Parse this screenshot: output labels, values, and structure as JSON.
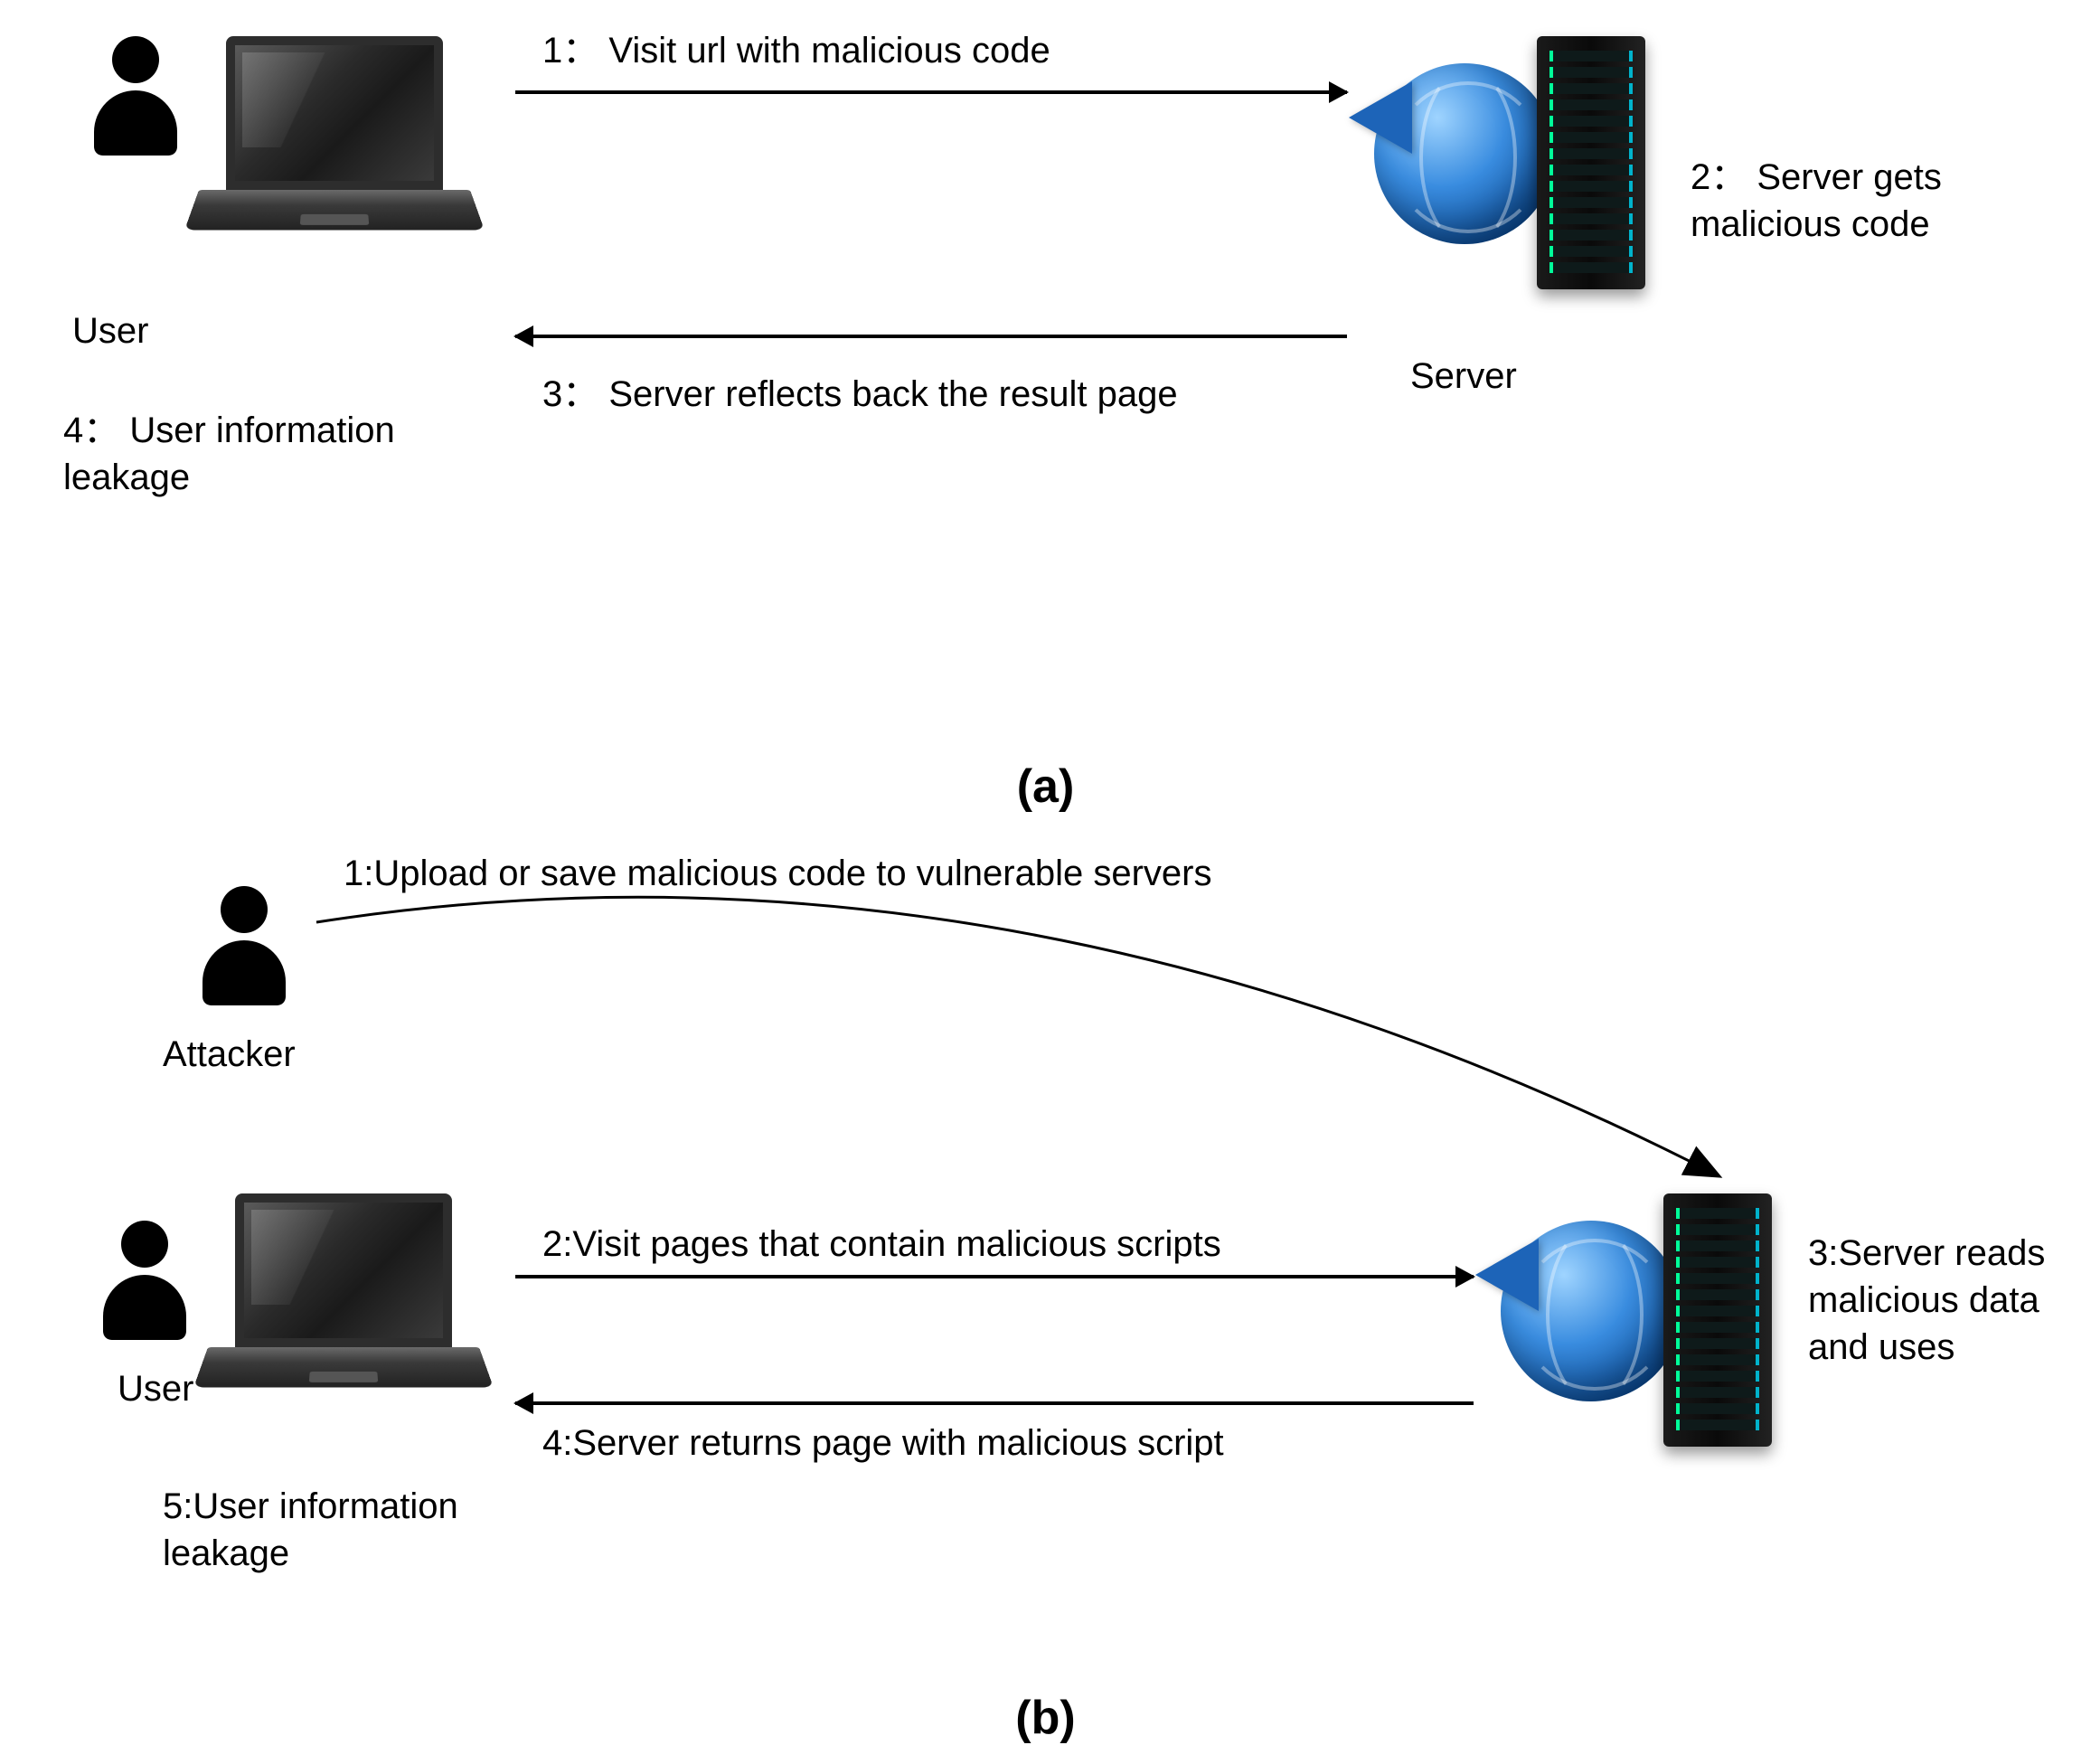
{
  "figure_labels": {
    "a": "(a)",
    "b": "(b)"
  },
  "diagram_a": {
    "user_label": "User",
    "server_label": "Server",
    "step1": "1： Visit url with malicious code",
    "step2": "2： Server gets malicious code",
    "step3": "3： Server reflects back the result page",
    "step4": "4： User information leakage"
  },
  "diagram_b": {
    "attacker_label": "Attacker",
    "user_label": "User",
    "step1": "1:Upload or save malicious code to vulnerable servers",
    "step2": "2:Visit pages that contain malicious scripts",
    "step3": "3:Server reads malicious data and uses",
    "step4": "4:Server returns page with malicious script",
    "step5": "5:User information leakage"
  }
}
